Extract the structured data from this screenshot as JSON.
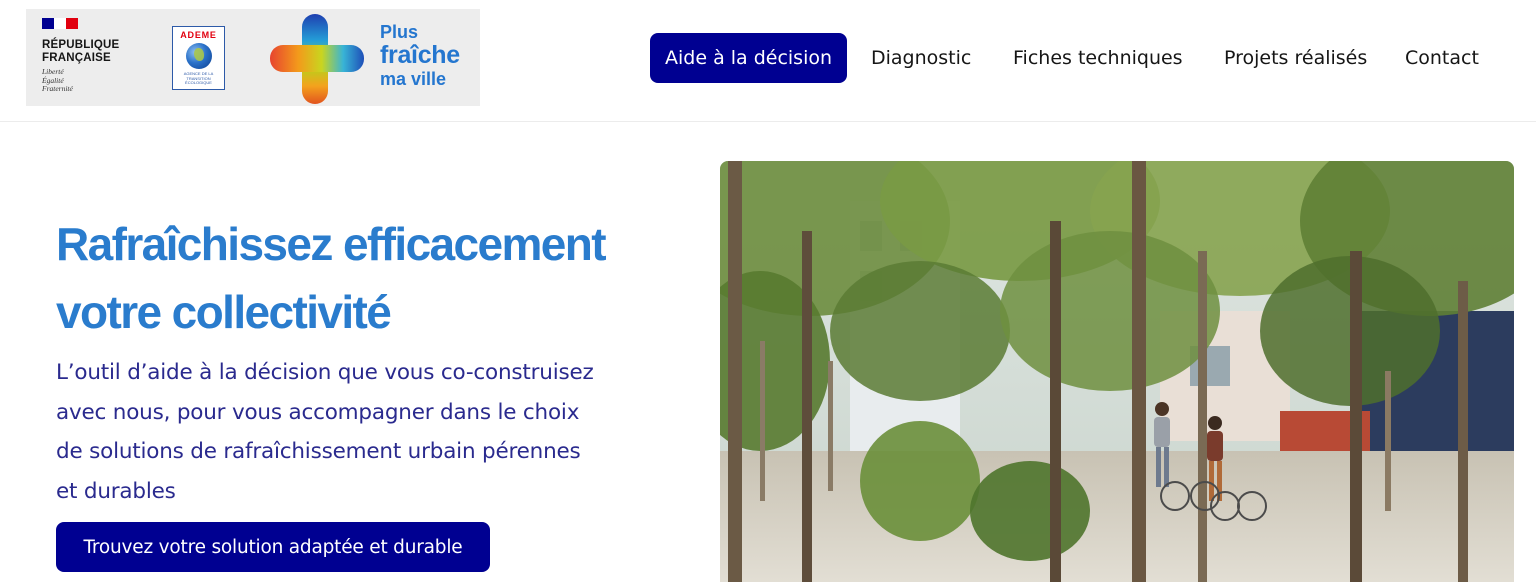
{
  "header": {
    "logos": {
      "republique": {
        "name_line1": "RÉPUBLIQUE",
        "name_line2": "FRANÇAISE",
        "motto_line1": "Liberté",
        "motto_line2": "Égalité",
        "motto_line3": "Fraternité",
        "flag_colors": [
          "#000091",
          "#ffffff",
          "#e1000f"
        ]
      },
      "ademe": {
        "title": "ADEME",
        "subtitle": "AGENCE DE LA TRANSITION ÉCOLOGIQUE"
      },
      "pfmv": {
        "line1": "Plus",
        "line2": "fraîche",
        "line3": "ma ville"
      }
    },
    "nav": [
      {
        "label": "Aide à la décision",
        "active": true
      },
      {
        "label": "Diagnostic",
        "active": false
      },
      {
        "label": "Fiches techniques",
        "active": false
      },
      {
        "label": "Projets réalisés",
        "active": false
      },
      {
        "label": "Contact",
        "active": false
      }
    ]
  },
  "hero": {
    "title_line1": "Rafraîchissez efficacement",
    "title_line2": "votre collectivité",
    "text_line1": "L’outil d’aide à la décision que vous co-construisez",
    "text_line2": "avec nous, pour vous accompagner dans le choix",
    "text_line3": "de solutions de rafraîchissement urbain pérennes",
    "text_line4": "et durables",
    "cta_label": "Trouvez votre solution adaptée et durable"
  },
  "colors": {
    "primary": "#000091",
    "title_blue": "#2a7ccd",
    "text_blue": "#2a2a8e"
  }
}
